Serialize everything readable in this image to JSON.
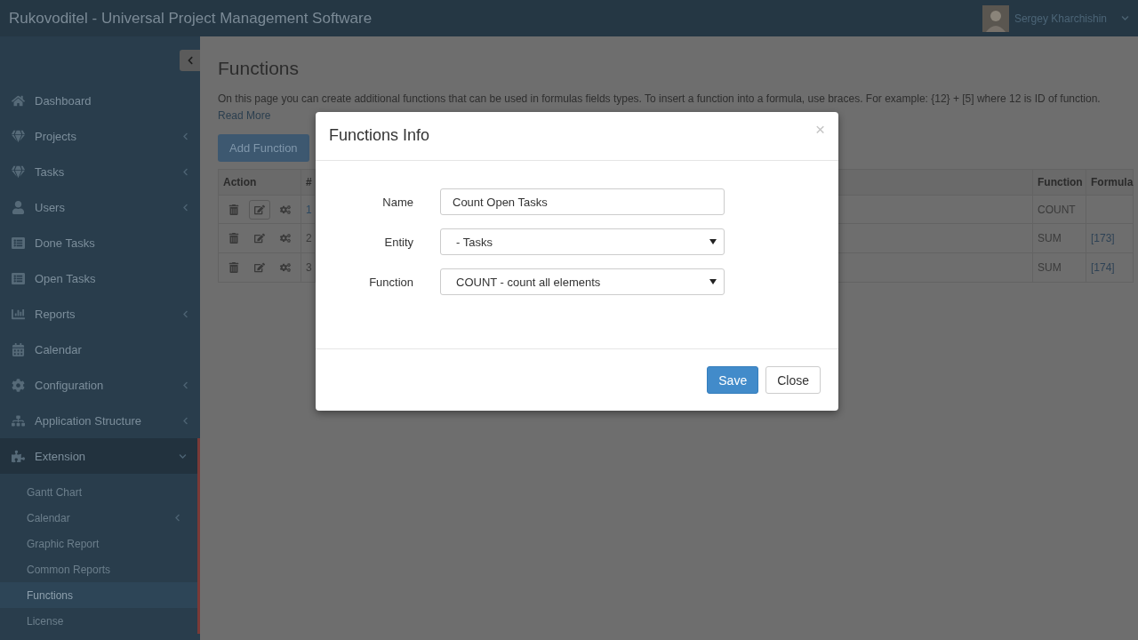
{
  "header": {
    "title": "Rukovoditel - Universal Project Management Software",
    "user": {
      "name": "Sergey Kharchishin"
    }
  },
  "sidebar": {
    "items": [
      {
        "label": "Dashboard",
        "has_submenu": false,
        "expanded": false
      },
      {
        "label": "Projects",
        "has_submenu": true,
        "expanded": false
      },
      {
        "label": "Tasks",
        "has_submenu": true,
        "expanded": false
      },
      {
        "label": "Users",
        "has_submenu": true,
        "expanded": false
      },
      {
        "label": "Done Tasks",
        "has_submenu": false,
        "expanded": false
      },
      {
        "label": "Open Tasks",
        "has_submenu": false,
        "expanded": false
      },
      {
        "label": "Reports",
        "has_submenu": true,
        "expanded": false
      },
      {
        "label": "Calendar",
        "has_submenu": false,
        "expanded": false
      },
      {
        "label": "Configuration",
        "has_submenu": true,
        "expanded": false
      },
      {
        "label": "Application Structure",
        "has_submenu": true,
        "expanded": false
      },
      {
        "label": "Extension",
        "has_submenu": true,
        "expanded": true,
        "children": [
          {
            "label": "Gantt Chart",
            "has_submenu": false,
            "selected": false
          },
          {
            "label": "Calendar",
            "has_submenu": true,
            "selected": false
          },
          {
            "label": "Graphic Report",
            "has_submenu": false,
            "selected": false
          },
          {
            "label": "Common Reports",
            "has_submenu": false,
            "selected": false
          },
          {
            "label": "Functions",
            "has_submenu": false,
            "selected": true
          },
          {
            "label": "License",
            "has_submenu": false,
            "selected": false
          }
        ]
      }
    ]
  },
  "page": {
    "title": "Functions",
    "description": "On this page you can create additional functions that can be used in formulas fields types. To insert a function into a formula, use braces. For example: {12} + [5] where 12 is ID of function.",
    "read_more": "Read More",
    "add_button": "Add Function",
    "table": {
      "columns": [
        "Action",
        "#",
        "Function",
        "Formula"
      ],
      "rows": [
        {
          "id": "1",
          "id_link": true,
          "function": "COUNT"
        },
        {
          "id": "2",
          "id_link": false,
          "function": "SUM",
          "formula": "[173]"
        },
        {
          "id": "3",
          "id_link": false,
          "function": "SUM",
          "formula": "[174]"
        }
      ]
    }
  },
  "dialog": {
    "title": "Functions Info",
    "close_symbol": "×",
    "fields": [
      {
        "label": "Name",
        "kind": "text",
        "value": "Count Open Tasks"
      },
      {
        "label": "Entity",
        "kind": "select",
        "value": "- Tasks"
      },
      {
        "label": "Function",
        "kind": "select",
        "value": "COUNT - count all elements"
      }
    ],
    "buttons": [
      {
        "label": "Save",
        "primary": true
      },
      {
        "label": "Close",
        "primary": false
      }
    ]
  }
}
